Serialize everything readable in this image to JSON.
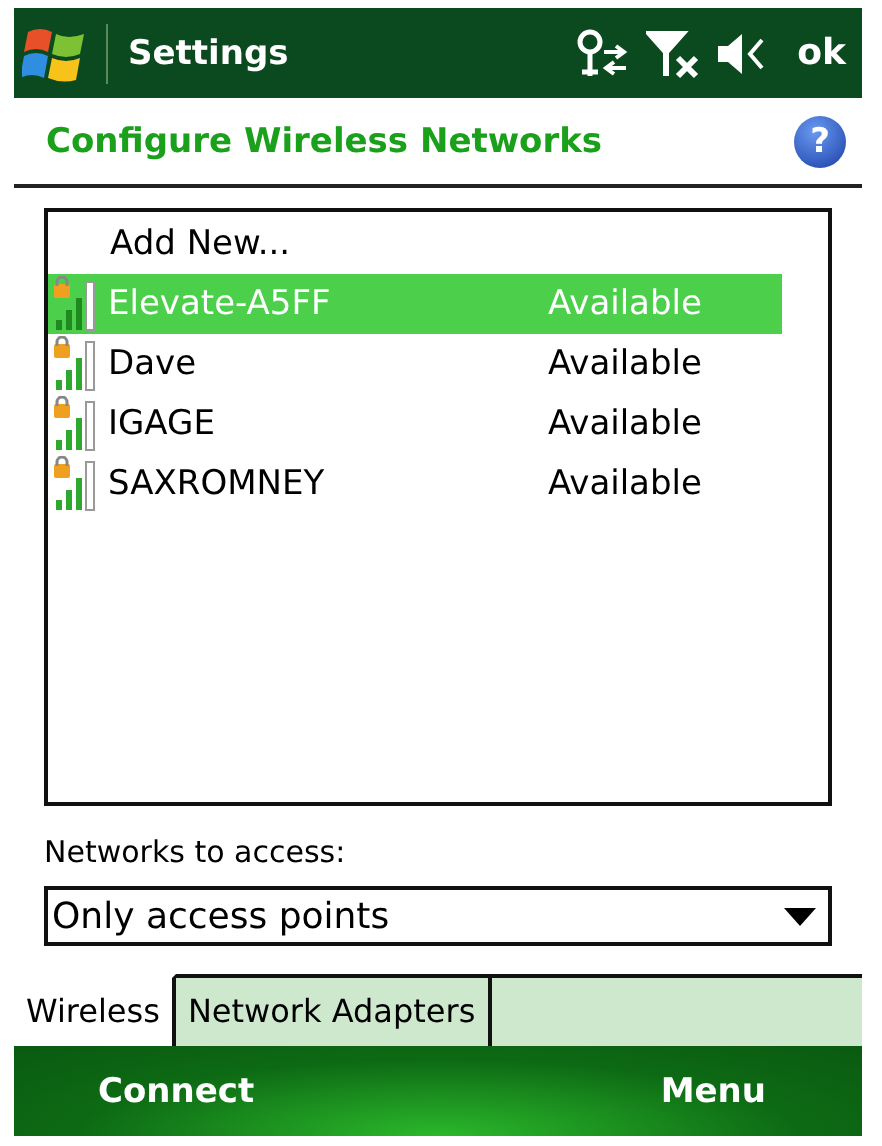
{
  "title_bar": {
    "title": "Settings",
    "ok": "ok"
  },
  "header": {
    "title": "Configure Wireless Networks",
    "help": "?"
  },
  "network_list": {
    "add_new": "Add New...",
    "networks": [
      {
        "name": "Elevate-A5FF",
        "status": "Available",
        "selected": true
      },
      {
        "name": "Dave",
        "status": "Available",
        "selected": false
      },
      {
        "name": "IGAGE",
        "status": "Available",
        "selected": false
      },
      {
        "name": "SAXROMNEY",
        "status": "Available",
        "selected": false
      }
    ]
  },
  "access": {
    "label": "Networks to access:",
    "value": "Only access points"
  },
  "tabs": [
    {
      "label": "Wireless",
      "selected": true
    },
    {
      "label": "Network Adapters",
      "selected": false
    }
  ],
  "softkeys": [
    "Connect",
    "Menu"
  ]
}
